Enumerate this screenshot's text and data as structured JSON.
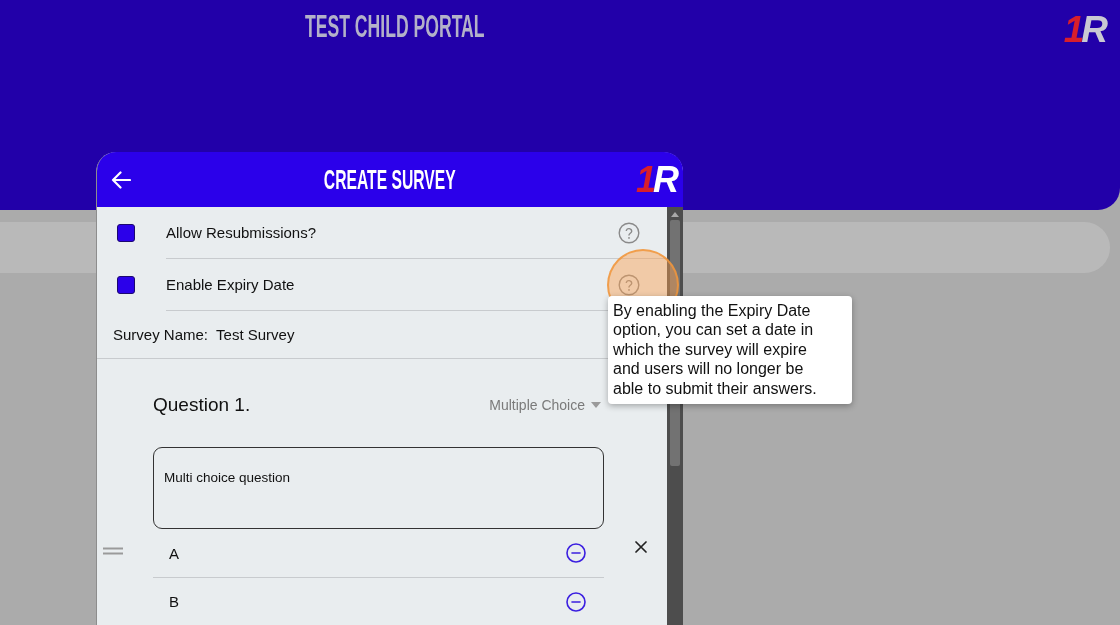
{
  "page": {
    "title": "TEST CHILD PORTAL",
    "logo": {
      "digit": "1",
      "letter": "R"
    }
  },
  "dialog": {
    "title": "CREATE SURVEY",
    "logo": {
      "digit": "1",
      "letter": "R"
    },
    "settings": [
      {
        "label": "Allow Resubmissions?",
        "checked": true
      },
      {
        "label": "Enable Expiry Date",
        "checked": true,
        "tooltip": "By enabling the Expiry Date option, you can set a date in which the survey will expire and users will no longer be able to submit their answers."
      }
    ],
    "survey_name": {
      "label": "Survey Name:",
      "value": "Test Survey"
    },
    "question": {
      "title": "Question 1.",
      "type": "Multiple Choice",
      "text": "Multi choice question",
      "options": [
        {
          "label": "A"
        },
        {
          "label": "B"
        }
      ]
    }
  }
}
